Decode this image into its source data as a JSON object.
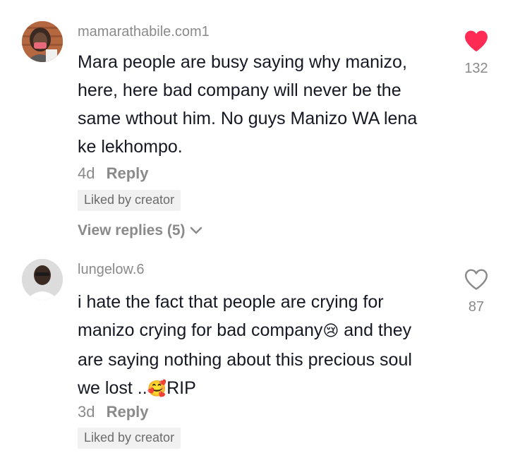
{
  "comments": [
    {
      "username": "mamarathabile.com1",
      "text": "Mara people are busy saying why manizo, here, here bad company will never be the same wthout him. No guys Manizo WA lena ke lekhompo.",
      "time": "4d",
      "reply_label": "Reply",
      "liked_badge": "Liked by creator",
      "view_replies_label": "View replies (5)",
      "like_count": "132",
      "liked": true,
      "like_color": "#fe2c55"
    },
    {
      "username": "lungelow.6",
      "text_parts": [
        "i hate the fact that people are crying for manizo crying for bad company",
        "😢",
        " and they are saying nothing about this precious soul we lost ..",
        "🥰",
        "RIP"
      ],
      "time": "3d",
      "reply_label": "Reply",
      "liked_badge": "Liked by creator",
      "like_count": "87",
      "liked": false
    }
  ]
}
